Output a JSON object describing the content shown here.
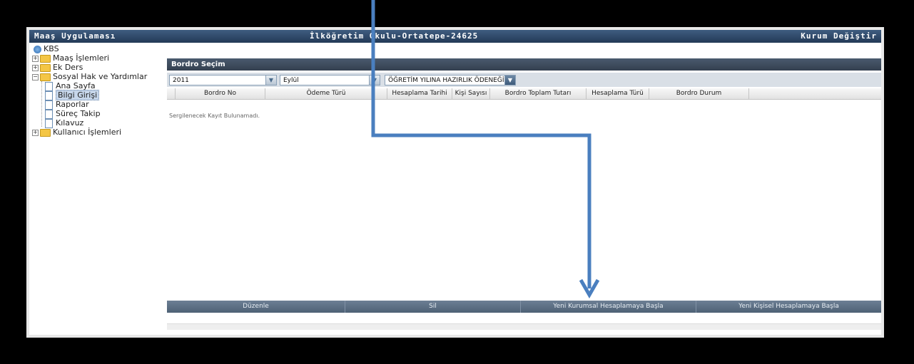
{
  "titlebar": {
    "app_title": "Maaş Uygulaması",
    "school": "İlköğretim Okulu-Ortatepe-24625",
    "change_link": "Kurum Değiştir"
  },
  "tree": {
    "root": "KBS",
    "items": [
      {
        "label": "Maaş İşlemleri"
      },
      {
        "label": "Ek Ders"
      },
      {
        "label": "Sosyal Hak ve Yardımlar"
      },
      {
        "label": "Ana Sayfa"
      },
      {
        "label": "Bilgi Girişi"
      },
      {
        "label": "Raporlar"
      },
      {
        "label": "Süreç Takip"
      },
      {
        "label": "Kılavuz"
      },
      {
        "label": "Kullanıcı İşlemleri"
      }
    ]
  },
  "panel": {
    "title": "Bordro Seçim",
    "year": "2011",
    "month": "Eylül",
    "payment_type": "ÖĞRETİM YILINA HAZIRLIK ÖDENEĞİ",
    "columns": [
      "Bordro No",
      "Ödeme Türü",
      "Hesaplama Tarihi",
      "Kişi Sayısı",
      "Bordro Toplam Tutarı",
      "Hesaplama Türü",
      "Bordro Durum"
    ],
    "empty_message": "Sergilenecek Kayıt Bulunamadı.",
    "buttons": [
      "Düzenle",
      "Sil",
      "Yeni Kurumsal Hesaplamaya Başla",
      "Yeni Kişisel Hesaplamaya Başla"
    ]
  },
  "colors": {
    "annotation_arrow": "#4a7fbf",
    "titlebar": "#2f4a6b"
  }
}
